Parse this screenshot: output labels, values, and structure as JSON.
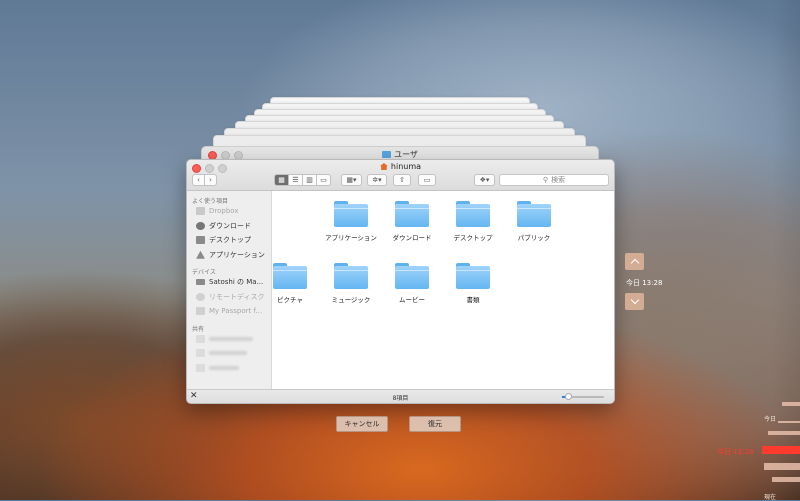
{
  "back_window": {
    "title": "ユーザ"
  },
  "window": {
    "title": "hinuma",
    "search_placeholder": "検索",
    "status": "8項目",
    "icon_size_fraction": 0.15
  },
  "sidebar": {
    "favorites_header": "よく使う項目",
    "favorites": [
      {
        "label": "Dropbox",
        "icon": "dropbox-icon"
      },
      {
        "label": "ダウンロード",
        "icon": "download-icon"
      },
      {
        "label": "デスクトップ",
        "icon": "desktop-icon"
      },
      {
        "label": "アプリケーション",
        "icon": "applications-icon"
      }
    ],
    "devices_header": "デバイス",
    "devices": [
      {
        "label": "Satoshi の Ma...",
        "icon": "laptop-icon"
      },
      {
        "label": "リモートディスク",
        "icon": "disc-icon"
      },
      {
        "label": "My Passport f...",
        "icon": "drive-icon"
      }
    ],
    "shared_header": "共有"
  },
  "folders": [
    {
      "label": "アプリケーション"
    },
    {
      "label": "ダウンロード"
    },
    {
      "label": "デスクトップ"
    },
    {
      "label": "パブリック"
    },
    {
      "label": "ピクチャ"
    },
    {
      "label": "ミュージック"
    },
    {
      "label": "ムービー"
    },
    {
      "label": "書類"
    }
  ],
  "buttons": {
    "cancel": "キャンセル",
    "restore": "復元"
  },
  "time_machine": {
    "current_time": "今日 13:28",
    "timeline_today": "今日",
    "timeline_now": "今日 13:28",
    "timeline_bottom": "現在"
  },
  "colors": {
    "accent": "#ff3b2f",
    "folder": "#64b6f1",
    "button": "#dec8ba"
  }
}
